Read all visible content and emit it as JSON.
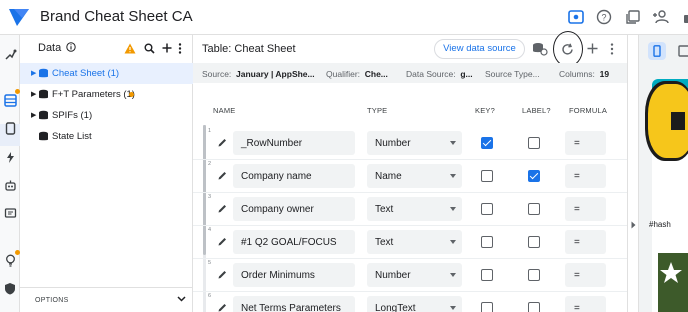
{
  "app": {
    "title": "Brand Cheat Sheet CA"
  },
  "data_panel": {
    "title": "Data",
    "items": [
      {
        "label": "Cheat Sheet (1)",
        "selected": true
      },
      {
        "label": "F+T Parameters (1)",
        "selected": false,
        "has_dot": true
      },
      {
        "label": "SPIFs (1)",
        "selected": false
      },
      {
        "label": "State List",
        "selected": false
      }
    ],
    "options_label": "OPTIONS"
  },
  "main": {
    "title": "Table: Cheat Sheet",
    "view_button": "View data source",
    "info": {
      "source_label": "Source:",
      "source_value": "January | AppShe...",
      "qualifier_label": "Qualifier:",
      "qualifier_value": "Che...",
      "datasource_label": "Data Source:",
      "datasource_value": "g...",
      "sourcetype_label": "Source Type...",
      "columns_label": "Columns:",
      "columns_value": "19"
    },
    "columns": {
      "name": "NAME",
      "type": "TYPE",
      "key": "KEY?",
      "label": "LABEL?",
      "formula": "FORMULA"
    },
    "rows": [
      {
        "num": "1",
        "name": "_RowNumber",
        "type": "Number",
        "key": true,
        "label": false,
        "formula": "="
      },
      {
        "num": "2",
        "name": "Company name",
        "type": "Name",
        "key": false,
        "label": true,
        "formula": "="
      },
      {
        "num": "3",
        "name": "Company owner",
        "type": "Text",
        "key": false,
        "label": false,
        "formula": "="
      },
      {
        "num": "4",
        "name": "#1 Q2 GOAL/FOCUS",
        "type": "Text",
        "key": false,
        "label": false,
        "formula": "="
      },
      {
        "num": "5",
        "name": "Order Minimums",
        "type": "Number",
        "key": false,
        "label": false,
        "formula": "="
      },
      {
        "num": "6",
        "name": "Net Terms Parameters",
        "type": "LongText",
        "key": false,
        "label": false,
        "formula": "="
      }
    ]
  },
  "preview": {
    "hash_text": "#hash"
  },
  "colors": {
    "accent": "#1a73e8",
    "selected_bg": "#e8f0fe",
    "warning": "#f29900",
    "preview_bar": "#00acc1"
  }
}
